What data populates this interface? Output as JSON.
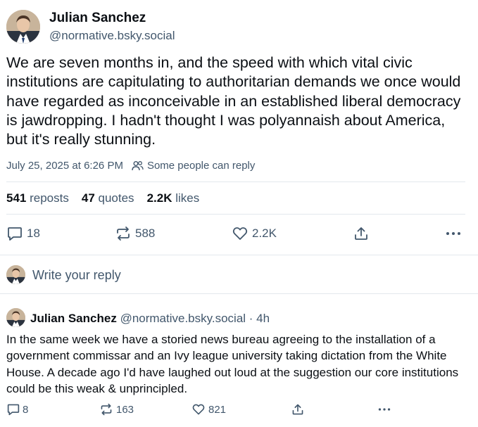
{
  "post": {
    "author_name": "Julian Sanchez",
    "author_handle": "@normative.bsky.social",
    "text": "We are seven months in, and the speed with which vital civic institutions are capitulating to authoritarian demands we once would have regarded as inconceivable in an established liberal democracy is jawdropping.  I hadn't thought I was polyannaish about America, but it's really stunning.",
    "timestamp": "July 25, 2025 at 6:26 PM",
    "reply_setting": "Some people can reply",
    "stats": {
      "reposts_count": "541",
      "reposts_label": "reposts",
      "quotes_count": "47",
      "quotes_label": "quotes",
      "likes_count": "2.2K",
      "likes_label": "likes"
    },
    "actions": {
      "replies": "18",
      "reposts": "588",
      "likes": "2.2K"
    }
  },
  "composer": {
    "placeholder": "Write your reply"
  },
  "reply": {
    "author_name": "Julian Sanchez",
    "author_handle": "@normative.bsky.social",
    "time": "· 4h",
    "text": "In the same week we have a storied news bureau agreeing to the installation of a government commissar and an Ivy league university taking dictation from the White House.  A decade ago I'd have laughed out loud at the suggestion our core institutions could be this weak & unprincipled.",
    "actions": {
      "replies": "8",
      "reposts": "163",
      "likes": "821"
    }
  },
  "icons": {
    "reply": "speech-bubble-icon",
    "repost": "repost-arrows-icon",
    "like": "heart-icon",
    "share": "share-upload-icon",
    "more": "more-dots-icon",
    "people": "people-icon"
  },
  "colors": {
    "text": "#0b0f14",
    "muted": "#42576c",
    "divider": "#e3e8ed",
    "background": "#ffffff"
  }
}
